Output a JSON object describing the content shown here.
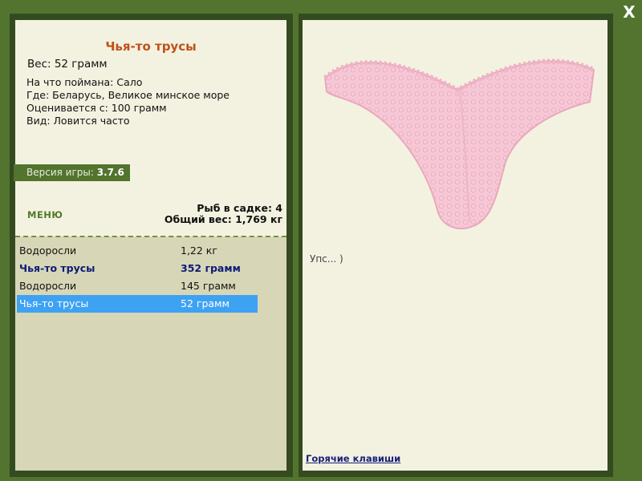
{
  "item": {
    "title": "Чья-то трусы",
    "weight": "Вес: 52 грамм",
    "details": [
      "На что поймана: Сало",
      "Где: Беларусь, Великое минское море",
      "Оценивается с: 100 грамм",
      "Вид: Ловится часто"
    ]
  },
  "version": {
    "label": "Версия игры:",
    "value": "3.7.6"
  },
  "menu_label": "МЕНЮ",
  "stats": {
    "fish_count": "Рыб в садке: 4",
    "total_weight": "Общий вес: 1,769 кг"
  },
  "catch_list": [
    {
      "name": "Водоросли",
      "weight": "1,22 кг"
    },
    {
      "name": "Чья-то трусы",
      "weight": "352 грамм"
    },
    {
      "name": "Водоросли",
      "weight": "145 грамм"
    },
    {
      "name": "Чья-то трусы",
      "weight": "52 грамм"
    }
  ],
  "comment": "Упс... )",
  "hotkeys_label": "Горячие клавиши",
  "close_label": "X",
  "colors": {
    "background": "#52742f",
    "panel": "#f3f2e0",
    "list_bg": "#d7d7b7",
    "title": "#c0501a",
    "selection": "#3ea2f3",
    "item_color": "#f7c9d7"
  }
}
